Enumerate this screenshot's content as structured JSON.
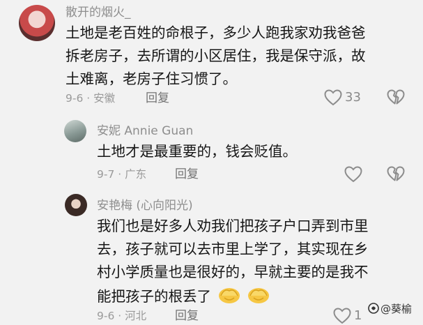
{
  "comments": [
    {
      "user": "散开的烟火_",
      "lines": [
        "土地是老百姓的命根子，多少人跑我家劝我爸爸",
        "拆老房子，去所谓的小区居住，我是保守派，故",
        "土难离，老房子住习惯了。"
      ],
      "date": "9-6 · 安徽",
      "reply_label": "回复",
      "likes": "33"
    },
    {
      "user": "安妮 Annie Guan",
      "lines": [
        "土地才是最重要的，钱会贬值。"
      ],
      "date": "9-7 · 广东",
      "reply_label": "回复",
      "likes": ""
    },
    {
      "user": "安艳梅 (心向阳光)",
      "lines": [
        "我们也是好多人劝我们把孩子户口弄到市里",
        "去，孩子就可以去市里上学了，其实现在乡",
        "村小学质量也是很好的，早就主要的是我不",
        "能把孩子的根丢了"
      ],
      "date": "9-6 · 河北",
      "reply_label": "回复",
      "likes": "1"
    }
  ],
  "icons": {
    "like": "heart-outline-icon",
    "dislike": "broken-heart-icon",
    "emoji": "cupped-hands-emoji-icon"
  },
  "watermark": "@葵榆",
  "colors": {
    "background": "#f2f2f2",
    "meta": "#9a9a9a",
    "text": "#161616"
  }
}
